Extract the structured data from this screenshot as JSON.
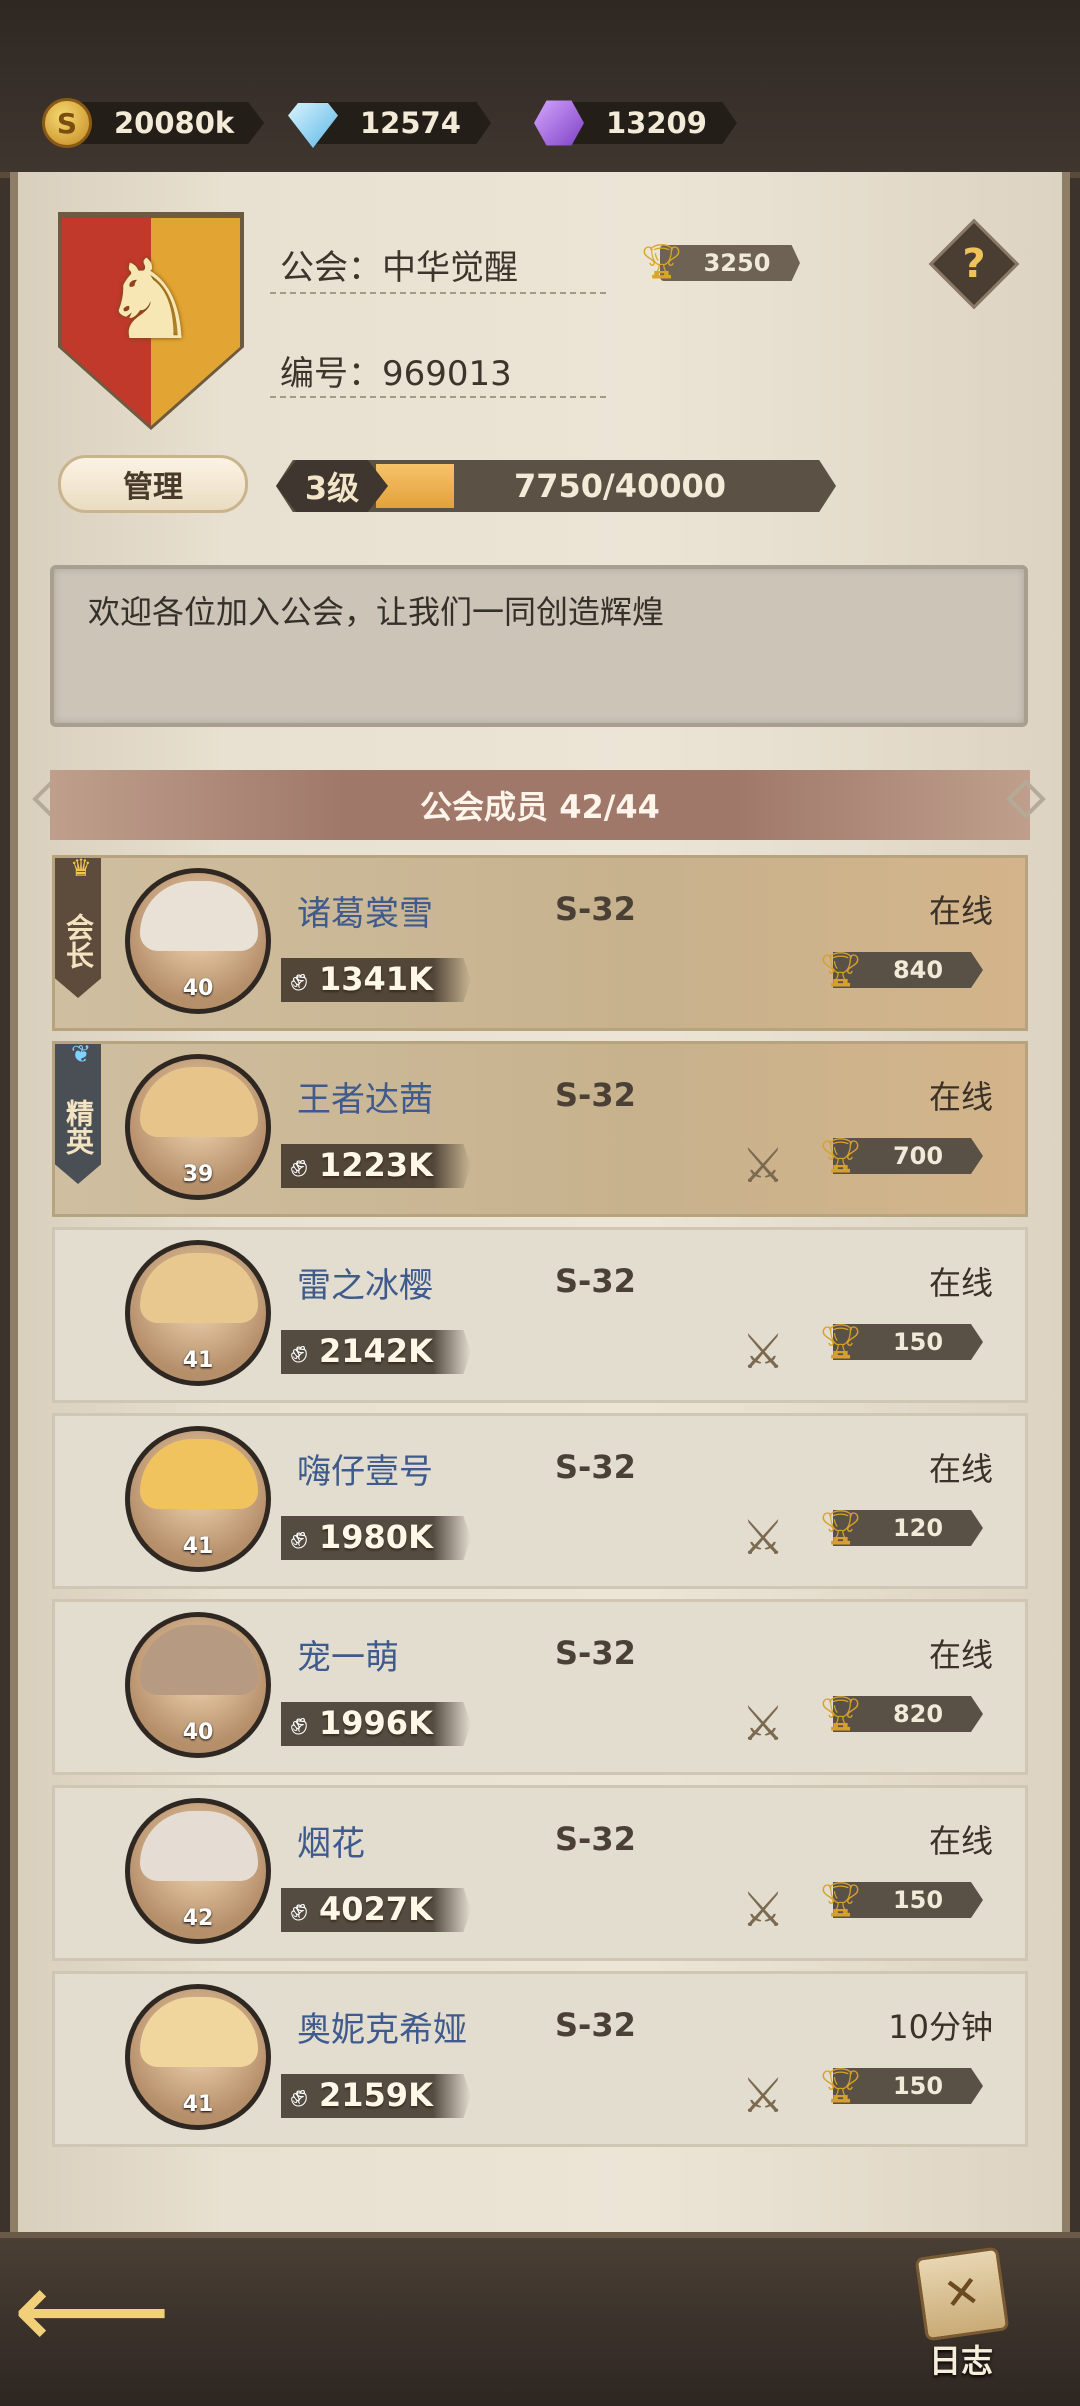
{
  "currencies": [
    {
      "icon": "gold-coin-icon",
      "value": "20080k"
    },
    {
      "icon": "diamond-icon",
      "value": "12574"
    },
    {
      "icon": "purple-gem-icon",
      "value": "13209"
    }
  ],
  "guild": {
    "name_label": "公会：中华觉醒",
    "id_label": "编号：969013",
    "trophies": "3250",
    "manage_label": "管理",
    "level": "3级",
    "exp_text": "7750/40000",
    "exp_progress": 0.194,
    "notice": "欢迎各位加入公会，让我们一同创造辉煌",
    "members_title": "公会成员 42/44"
  },
  "members": [
    {
      "role": "会长",
      "name": "诸葛裳雪",
      "level": "40",
      "server": "S-32",
      "status": "在线",
      "power": "1341K",
      "trophies": "840",
      "show_swords": false
    },
    {
      "role": "精英",
      "name": "王者达茜",
      "level": "39",
      "server": "S-32",
      "status": "在线",
      "power": "1223K",
      "trophies": "700",
      "show_swords": true
    },
    {
      "role": "",
      "name": "雷之冰樱",
      "level": "41",
      "server": "S-32",
      "status": "在线",
      "power": "2142K",
      "trophies": "150",
      "show_swords": true
    },
    {
      "role": "",
      "name": "嗨仔壹号",
      "level": "41",
      "server": "S-32",
      "status": "在线",
      "power": "1980K",
      "trophies": "120",
      "show_swords": true
    },
    {
      "role": "",
      "name": "宠一萌",
      "level": "40",
      "server": "S-32",
      "status": "在线",
      "power": "1996K",
      "trophies": "820",
      "show_swords": true
    },
    {
      "role": "",
      "name": "烟花",
      "level": "42",
      "server": "S-32",
      "status": "在线",
      "power": "4027K",
      "trophies": "150",
      "show_swords": true
    },
    {
      "role": "",
      "name": "奥妮克希娅",
      "level": "41",
      "server": "S-32",
      "status": "10分钟",
      "power": "2159K",
      "trophies": "150",
      "show_swords": true
    }
  ],
  "bottom": {
    "log_label": "日志"
  },
  "colors": {
    "accent_gold": "#d9a526",
    "member_name": "#3f5a8c",
    "header_band": "#a0786a"
  }
}
